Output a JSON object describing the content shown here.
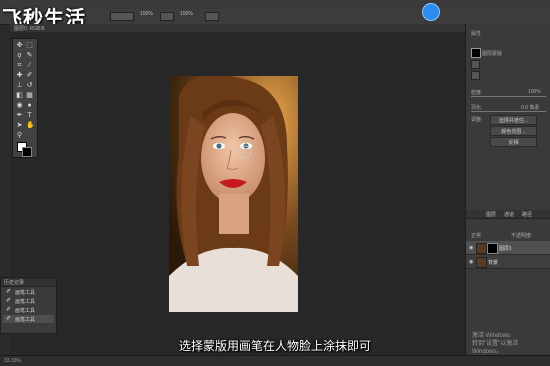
{
  "logo": {
    "text": "飞秒生活"
  },
  "subtitle": "选择蒙版用画笔在人物脸上涂抹即可",
  "activate": {
    "line1": "激活 Windows",
    "line2": "转到\"设置\"以激活 Windows。"
  },
  "status": {
    "zoom": "33.33%"
  },
  "doc_tab": "图层0, RGB/8",
  "colors": {
    "accent": "#2d8cf0",
    "lips": "#c21a1f"
  },
  "options_bar": {
    "opacity": "100%",
    "flow": "100%"
  },
  "right_panel": {
    "properties_label": "属性",
    "layer_mask_label": "图层蒙版",
    "density_label": "密度:",
    "density_value": "100%",
    "feather_label": "羽化:",
    "feather_value": "0.0 像素",
    "refine_label": "调整:",
    "buttons": [
      "选择并遮住...",
      "颜色范围...",
      "反相"
    ],
    "tabs": [
      "图层",
      "通道",
      "路径"
    ],
    "blend_mode": "正常",
    "opacity_label": "不透明度:",
    "layers": [
      {
        "name": "图层1",
        "selected": true,
        "has_mask": true
      },
      {
        "name": "背景",
        "selected": false,
        "has_mask": false
      }
    ]
  },
  "history": {
    "title": "历史记录",
    "items": [
      "画笔工具",
      "画笔工具",
      "画笔工具",
      "画笔工具"
    ]
  }
}
